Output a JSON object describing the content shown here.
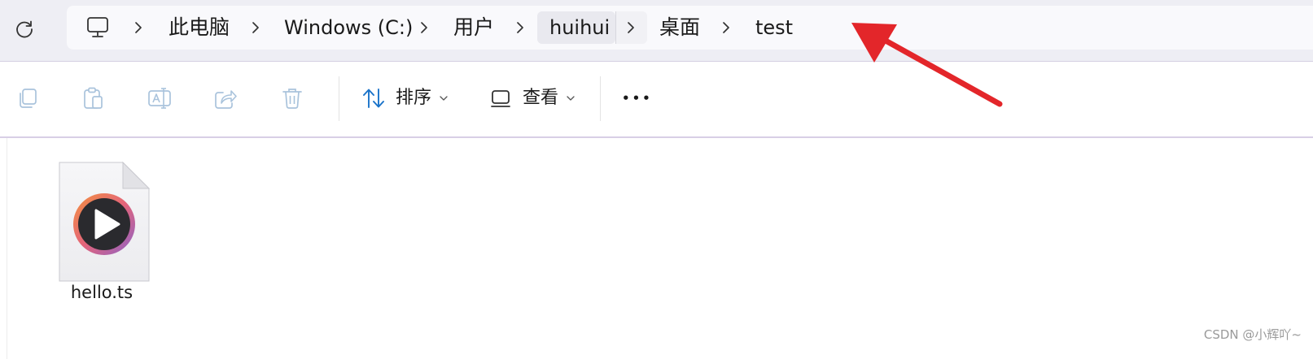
{
  "address_bar": {
    "breadcrumbs": [
      "此电脑",
      "Windows (C:)",
      "用户",
      "huihui",
      "桌面",
      "test"
    ]
  },
  "toolbar": {
    "sort_label": "排序",
    "view_label": "查看",
    "more_label": "•••"
  },
  "files": [
    {
      "name": "hello.ts",
      "icon": "media-player-icon"
    }
  ],
  "watermark": "CSDN @小辉吖~",
  "colors": {
    "accent": "#1a73c9",
    "annotation_arrow": "#e3262a",
    "address_bg": "#eeeef4",
    "highlight_crumb": "#e9e9ef"
  }
}
